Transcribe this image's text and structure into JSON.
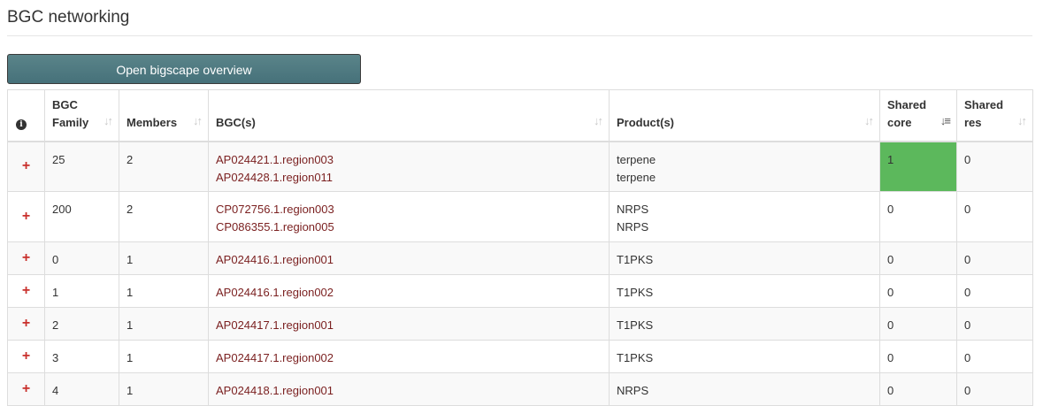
{
  "page": {
    "title": "BGC networking"
  },
  "toolbar": {
    "overview_label": "Open bigscape overview"
  },
  "table": {
    "headers": {
      "family_line1": "BGC",
      "family_line2": "Family",
      "members": "Members",
      "bgcs": "BGC(s)",
      "products": "Product(s)",
      "core_line1": "Shared",
      "core_line2": "core",
      "res_line1": "Shared",
      "res_line2": "res"
    },
    "expand_symbol": "+",
    "info_symbol": "i",
    "sort_symbol": "↓↑",
    "sort_active_symbol": "↓≡",
    "rows": [
      {
        "family": "25",
        "members": "2",
        "bgcs": [
          "AP024421.1.region003",
          "AP024428.1.region011"
        ],
        "products": [
          "terpene",
          "terpene"
        ],
        "shared_core": "1",
        "shared_res": "0"
      },
      {
        "family": "200",
        "members": "2",
        "bgcs": [
          "CP072756.1.region003",
          "CP086355.1.region005"
        ],
        "products": [
          "NRPS",
          "NRPS"
        ],
        "shared_core": "0",
        "shared_res": "0"
      },
      {
        "family": "0",
        "members": "1",
        "bgcs": [
          "AP024416.1.region001"
        ],
        "products": [
          "T1PKS"
        ],
        "shared_core": "0",
        "shared_res": "0"
      },
      {
        "family": "1",
        "members": "1",
        "bgcs": [
          "AP024416.1.region002"
        ],
        "products": [
          "T1PKS"
        ],
        "shared_core": "0",
        "shared_res": "0"
      },
      {
        "family": "2",
        "members": "1",
        "bgcs": [
          "AP024417.1.region001"
        ],
        "products": [
          "T1PKS"
        ],
        "shared_core": "0",
        "shared_res": "0"
      },
      {
        "family": "3",
        "members": "1",
        "bgcs": [
          "AP024417.1.region002"
        ],
        "products": [
          "T1PKS"
        ],
        "shared_core": "0",
        "shared_res": "0"
      },
      {
        "family": "4",
        "members": "1",
        "bgcs": [
          "AP024418.1.region001"
        ],
        "products": [
          "NRPS"
        ],
        "shared_core": "0",
        "shared_res": "0"
      }
    ]
  },
  "colors": {
    "highlight": "#5cb85c",
    "link": "#7a1f1f",
    "expand": "#c9302c",
    "button": "#4f7a80"
  }
}
